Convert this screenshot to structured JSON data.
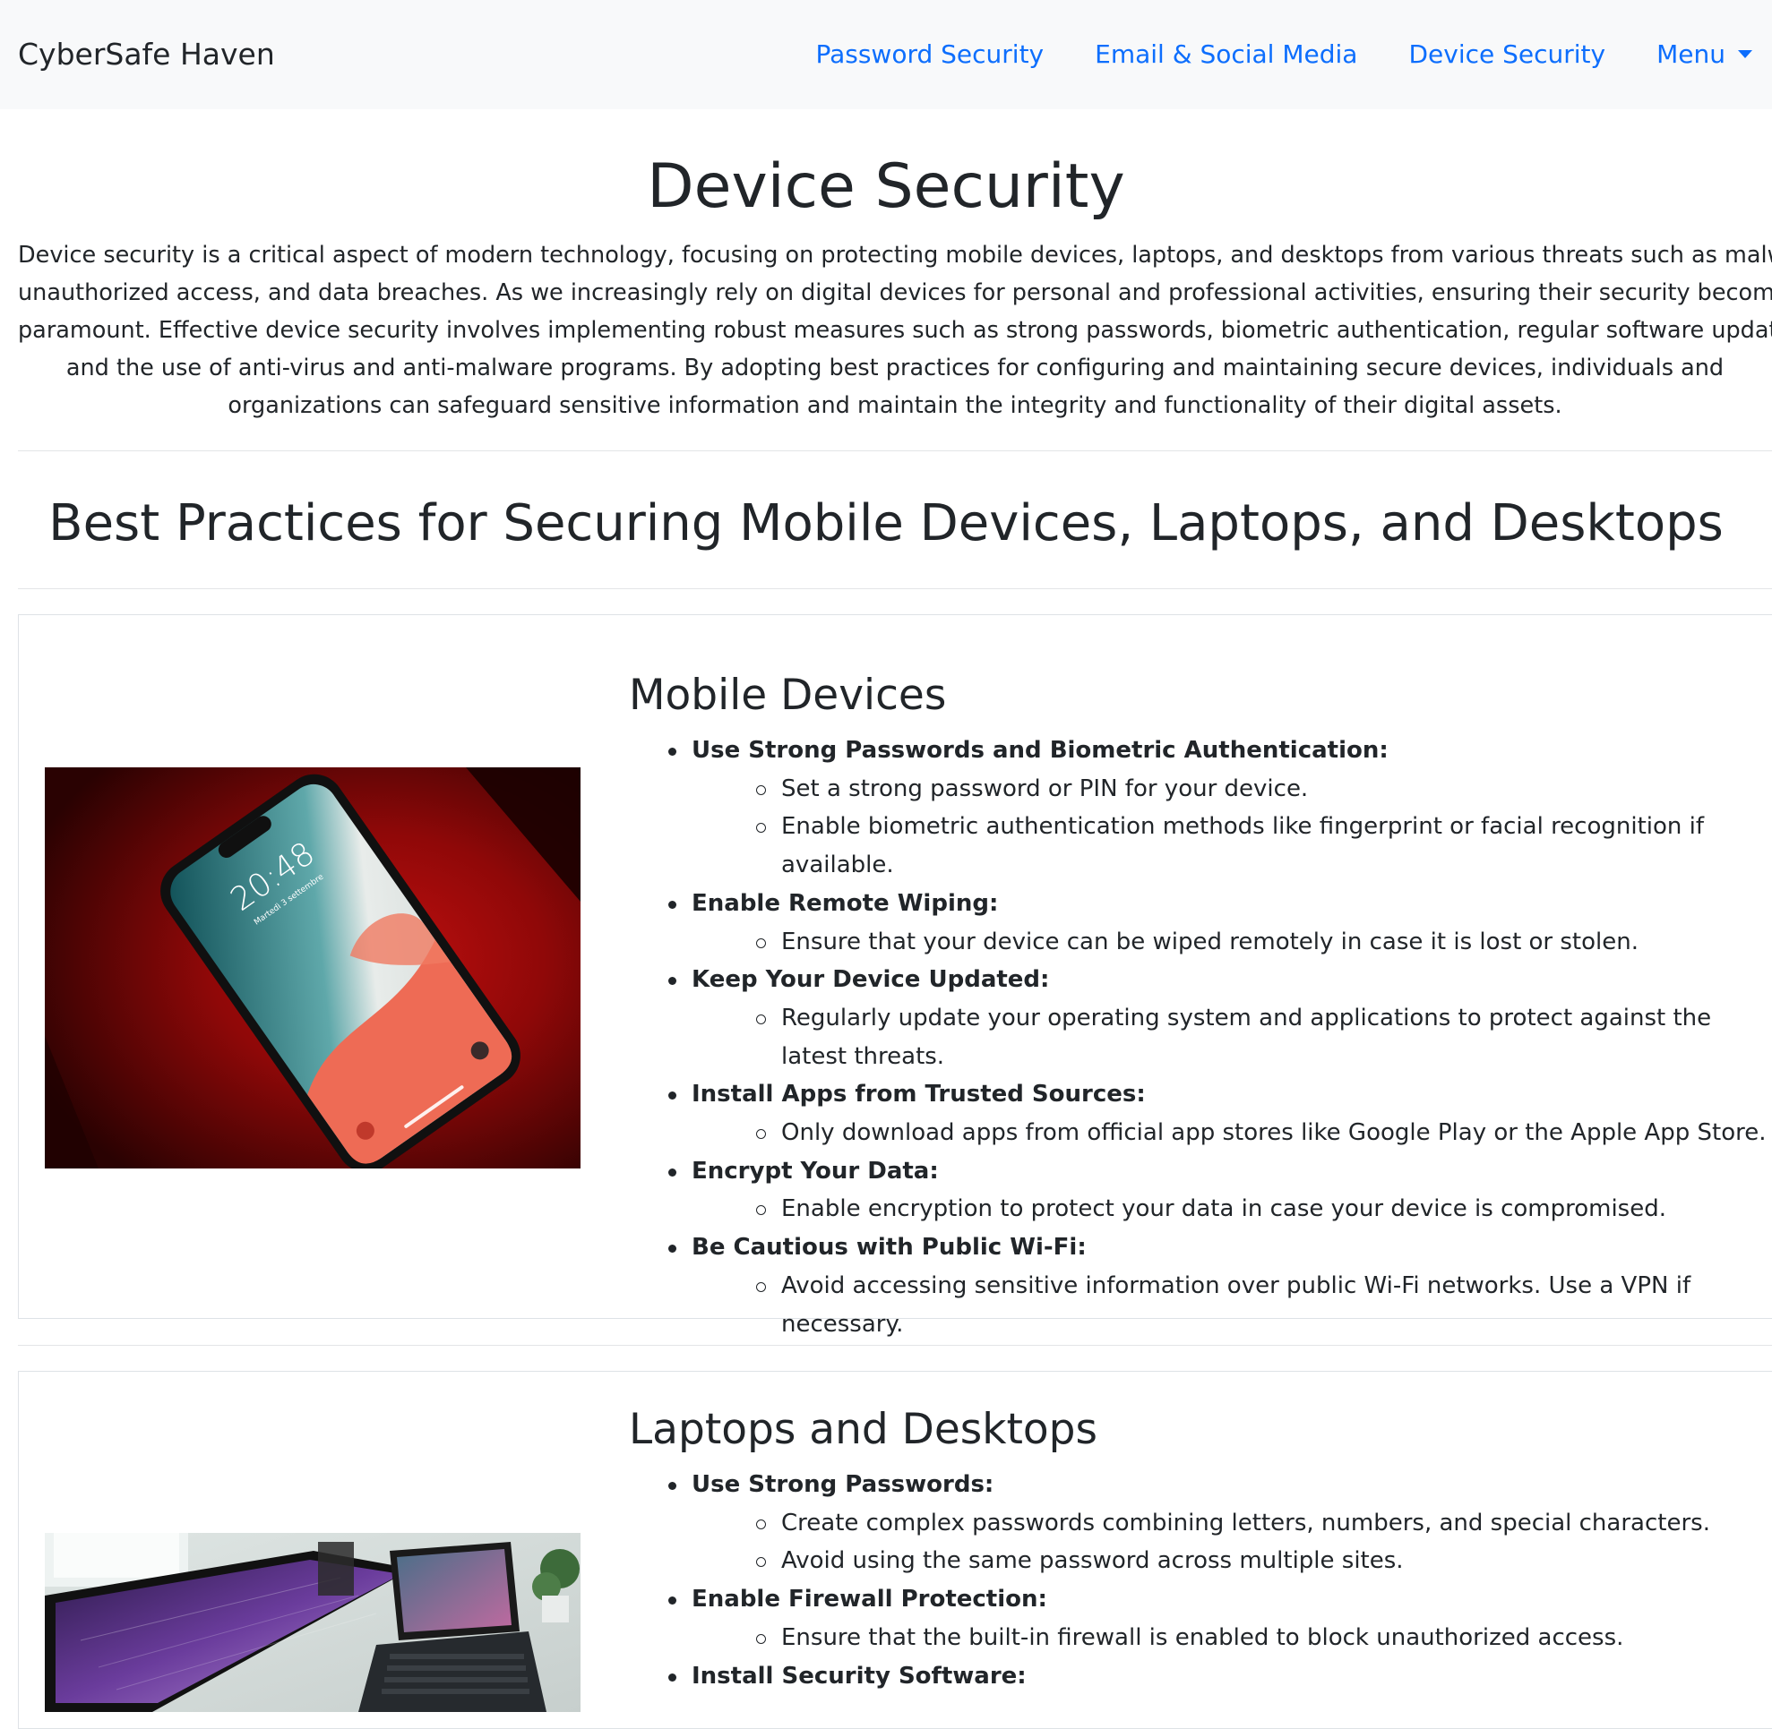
{
  "navbar": {
    "brand": "CyberSafe Haven",
    "links": [
      "Password Security",
      "Email & Social Media",
      "Device Security"
    ],
    "menu_label": "Menu"
  },
  "header": {
    "title": "Device Security",
    "intro_lines": [
      "Device security is a critical aspect of modern technology, focusing on protecting mobile devices, laptops, and desktops from various threats such as malware,",
      "unauthorized access, and data breaches. As we increasingly rely on digital devices for personal and professional activities, ensuring their security becomes",
      "paramount. Effective device security involves implementing robust measures such as strong passwords, biometric authentication, regular software updates,",
      "and the use of anti-virus and anti-malware programs. By adopting best practices for configuring and maintaining secure devices, individuals and",
      "organizations can safeguard sensitive information and maintain the integrity and functionality of their digital assets."
    ]
  },
  "best_practices_title": "Best Practices for Securing Mobile Devices, Laptops, and Desktops",
  "mobile": {
    "heading": "Mobile Devices",
    "image": {
      "phone_time": "20:48",
      "phone_date": "Martedì 3 settembre"
    },
    "tips": [
      {
        "title": "Use Strong Passwords and Biometric Authentication:",
        "items": [
          "Set a strong password or PIN for your device.",
          "Enable biometric authentication methods like fingerprint or facial recognition if available."
        ]
      },
      {
        "title": "Enable Remote Wiping:",
        "items": [
          "Ensure that your device can be wiped remotely in case it is lost or stolen."
        ]
      },
      {
        "title": "Keep Your Device Updated:",
        "items": [
          "Regularly update your operating system and applications to protect against the latest threats."
        ]
      },
      {
        "title": "Install Apps from Trusted Sources:",
        "items": [
          "Only download apps from official app stores like Google Play or the Apple App Store."
        ]
      },
      {
        "title": "Encrypt Your Data:",
        "items": [
          "Enable encryption to protect your data in case your device is compromised."
        ]
      },
      {
        "title": "Be Cautious with Public Wi-Fi:",
        "items": [
          "Avoid accessing sensitive information over public Wi-Fi networks. Use a VPN if necessary."
        ]
      }
    ]
  },
  "laptops": {
    "heading": "Laptops and Desktops",
    "tips": [
      {
        "title": "Use Strong Passwords:",
        "items": [
          "Create complex passwords combining letters, numbers, and special characters.",
          "Avoid using the same password across multiple sites."
        ]
      },
      {
        "title": "Enable Firewall Protection:",
        "items": [
          "Ensure that the built-in firewall is enabled to block unauthorized access."
        ]
      },
      {
        "title": "Install Security Software:",
        "items": []
      }
    ]
  }
}
